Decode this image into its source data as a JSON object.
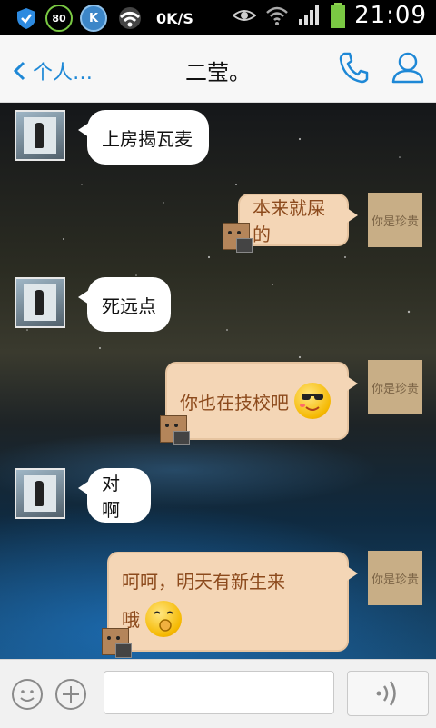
{
  "status_bar": {
    "badge_80": "80",
    "badge_k": "K",
    "speed": "0K/S",
    "time": "21:09"
  },
  "header": {
    "back_label": "个人…",
    "title": "二莹。",
    "accent_color": "#1e88d6"
  },
  "messages": [
    {
      "side": "left",
      "text": "上房揭瓦麦"
    },
    {
      "side": "right",
      "text": "本来就屎的"
    },
    {
      "side": "left",
      "text": "死远点"
    },
    {
      "side": "right",
      "text": "你也在技校吧",
      "emoji": "cool-face"
    },
    {
      "side": "left",
      "text": "对啊"
    },
    {
      "side": "right",
      "text": "呵呵，明天有新生来",
      "text2": "哦",
      "emoji": "yummy-face"
    }
  ],
  "self_avatar_text": "你是珍贵",
  "composer": {
    "input_value": ""
  }
}
